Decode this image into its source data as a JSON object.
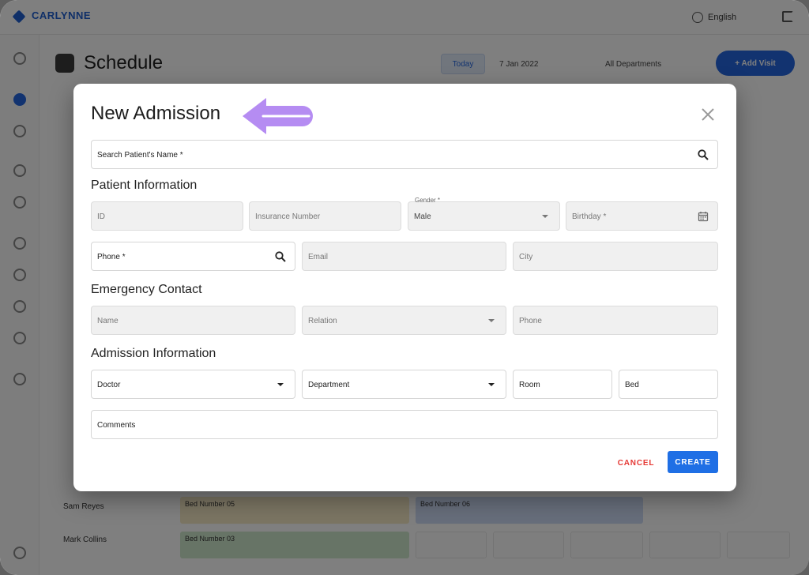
{
  "app": {
    "logo_text": "CARLYNNE",
    "language": "English",
    "page_title": "Schedule",
    "today_label": "Today",
    "date_label": "7 Jan 2022",
    "department_label": "All Departments",
    "add_button": "+ Add Visit",
    "rows": [
      {
        "name": "Sam Reyes"
      },
      {
        "name": "Mark Collins"
      }
    ],
    "events": [
      {
        "label": "Bed Number 05"
      },
      {
        "label": "Bed Number 06"
      },
      {
        "label": "Bed Number 03"
      }
    ]
  },
  "modal": {
    "title": "New Admission",
    "search_patient_label": "Search Patient's Name *",
    "sections": {
      "patient": "Patient Information",
      "emergency": "Emergency Contact",
      "admission": "Admission Information"
    },
    "patient_fields": {
      "id_label": "ID",
      "insurance_label": "Insurance Number",
      "gender_label": "Gender *",
      "gender_value": "Male",
      "birthday_label": "Birthday *",
      "phone_label": "Phone *",
      "email_label": "Email",
      "city_label": "City"
    },
    "emergency_fields": {
      "name_label": "Name",
      "relation_label": "Relation",
      "phone_label": "Phone"
    },
    "admission_fields": {
      "doctor_label": "Doctor",
      "department_label": "Department",
      "room_label": "Room",
      "bed_label": "Bed",
      "comments_label": "Comments"
    },
    "cancel_label": "CANCEL",
    "create_label": "CREATE"
  },
  "colors": {
    "primary": "#1f6fe5",
    "cancel": "#e53935",
    "arrow": "#b58cf2"
  },
  "icons": [
    "search-icon",
    "calendar-icon",
    "dropdown-arrow-icon",
    "close-icon",
    "arrow-left-icon"
  ]
}
